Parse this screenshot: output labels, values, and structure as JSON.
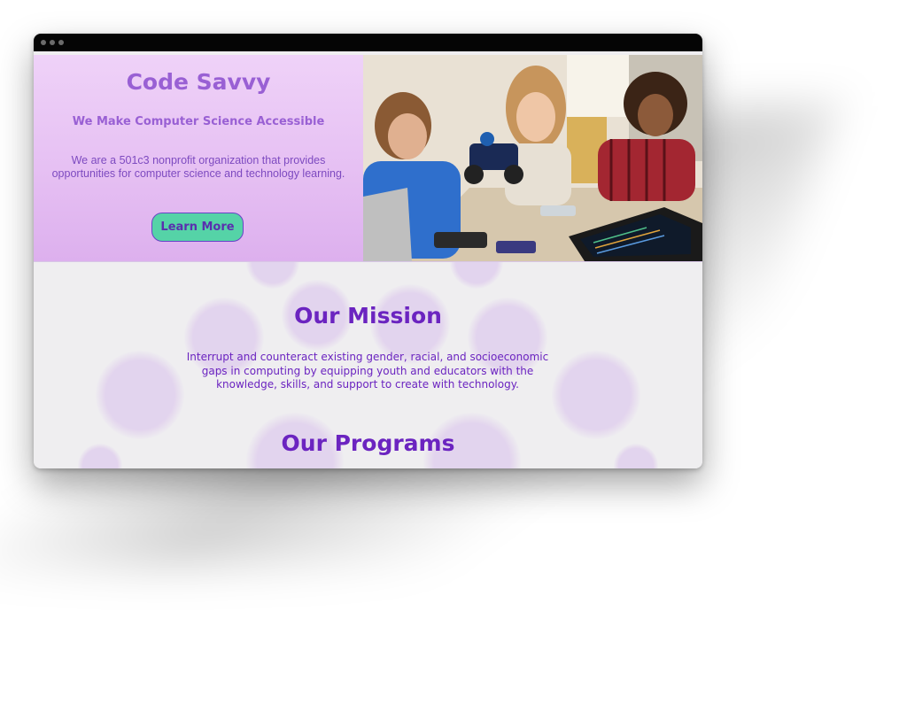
{
  "hero": {
    "title": "Code Savvy",
    "subtitle": "We Make Computer Science Accessible",
    "description": "We are a 501c3 nonprofit organization that provides opportunities for computer science and technology learning.",
    "button_label": "Learn More",
    "image_alt": "kids-building-robot-photo"
  },
  "mission": {
    "title": "Our Mission",
    "text": "Interrupt and counteract existing gender, racial, and socioeconomic gaps in computing by equipping youth and educators with the knowledge, skills, and support to create with technology."
  },
  "programs": {
    "title": "Our Programs"
  },
  "colors": {
    "accent": "#6b24c0",
    "hero_title": "#9960d4",
    "button_bg": "#55d3a7",
    "hero_bg": "#e6c0f3",
    "page_bg": "#efeef0"
  }
}
